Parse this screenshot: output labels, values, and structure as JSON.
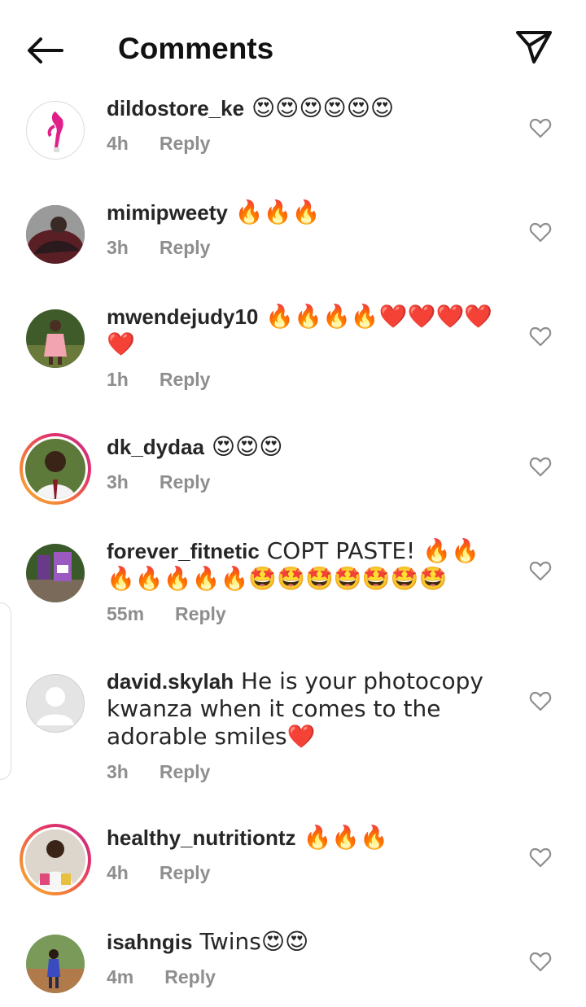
{
  "header": {
    "title": "Comments",
    "back_icon": "arrow-left-icon",
    "share_icon": "paper-plane-icon"
  },
  "reply_label": "Reply",
  "colors": {
    "text": "#262626",
    "meta": "#8e8e8e",
    "story_ring_start": "#f9b233",
    "story_ring_end": "#c13584"
  },
  "comments": [
    {
      "username": "dildostore_ke",
      "text": " 😍😍😍😍😍😍",
      "time": "4h",
      "story": false
    },
    {
      "username": "mimipweety",
      "text": " 🔥🔥🔥",
      "time": "3h",
      "story": false
    },
    {
      "username": "mwendejudy10",
      "text": " 🔥🔥🔥🔥❤️❤️❤️❤️❤️",
      "time": "1h",
      "story": false
    },
    {
      "username": "dk_dydaa",
      "text": " 😍😍😍",
      "time": "3h",
      "story": true
    },
    {
      "username": "forever_fitnetic",
      "text": " COPT PASTE! 🔥🔥🔥🔥🔥🔥🔥🤩🤩🤩🤩🤩🤩🤩",
      "time": "55m",
      "story": false
    },
    {
      "username": "david.skylah",
      "text": " He is your photocopy kwanza when it comes to the adorable smiles❤️",
      "time": "3h",
      "story": false
    },
    {
      "username": "healthy_nutritiontz",
      "text": " 🔥🔥🔥",
      "time": "4h",
      "story": true
    },
    {
      "username": "isahngis",
      "text": " Twins😍😍",
      "time": "4m",
      "story": false
    }
  ]
}
